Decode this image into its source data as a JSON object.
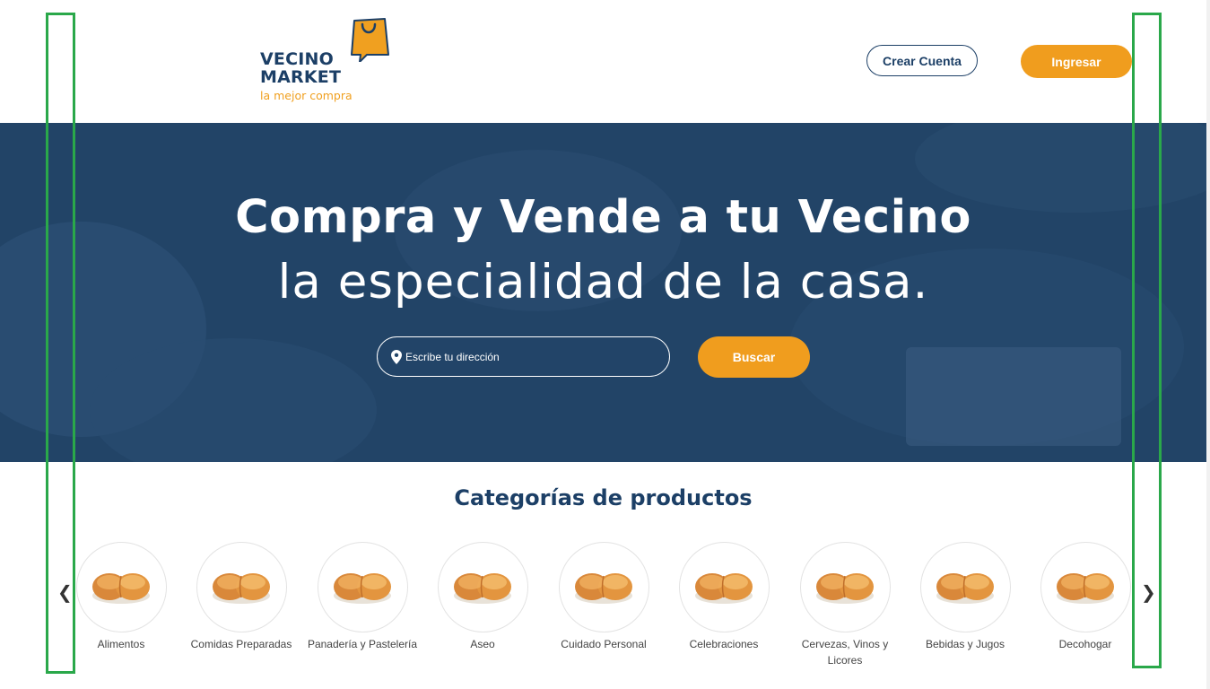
{
  "header": {
    "logo": {
      "line1": "VECINO",
      "line2": "MARKET",
      "tagline": "la mejor compra"
    },
    "create_account": "Crear Cuenta",
    "login": "Ingresar"
  },
  "hero": {
    "title": "Compra y Vende a tu Vecino",
    "subtitle": "la especialidad de la casa.",
    "address_placeholder": "Escribe tu dirección",
    "search_button": "Buscar"
  },
  "categories": {
    "title": "Categorías de productos",
    "items": [
      {
        "label": "Alimentos",
        "icon": "bread-roll-icon"
      },
      {
        "label": "Comidas Preparadas",
        "icon": "bread-roll-icon"
      },
      {
        "label": "Panadería y Pastelería",
        "icon": "bread-roll-icon"
      },
      {
        "label": "Aseo",
        "icon": "bread-roll-icon"
      },
      {
        "label": "Cuidado Personal",
        "icon": "bread-roll-icon"
      },
      {
        "label": "Celebraciones",
        "icon": "bread-roll-icon"
      },
      {
        "label": "Cervezas, Vinos y Licores",
        "icon": "bread-roll-icon"
      },
      {
        "label": "Bebidas y Jugos",
        "icon": "bread-roll-icon"
      },
      {
        "label": "Decohogar",
        "icon": "bread-roll-icon"
      }
    ],
    "prev_arrow": "❮",
    "next_arrow": "❯"
  },
  "colors": {
    "navy": "#1c3f66",
    "orange": "#f09d1e",
    "hero_overlay": "#234669",
    "highlight_frame": "#2aa84a"
  }
}
